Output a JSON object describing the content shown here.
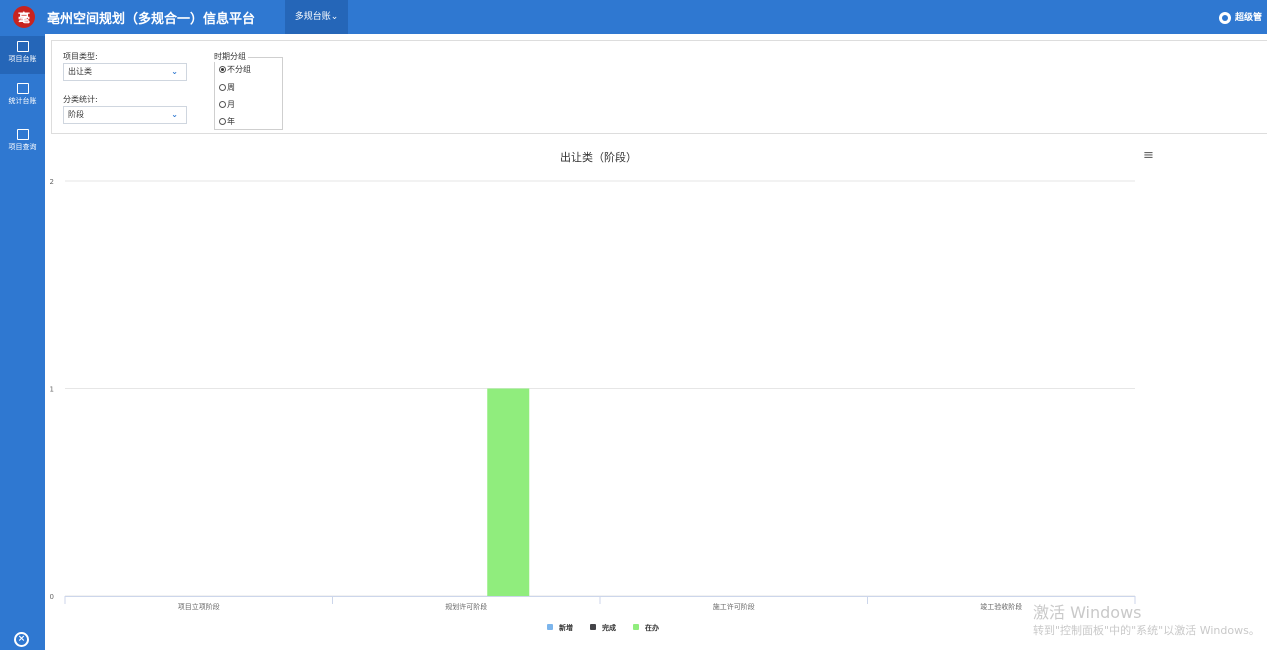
{
  "app": {
    "logo_glyph": "毫",
    "title": "亳州空间规划（多规合一）信息平台",
    "menu_active": "多规台账⌄",
    "user": "超级管"
  },
  "sidebar": {
    "items": [
      {
        "label": "项目台账",
        "icon": "ledger-icon"
      },
      {
        "label": "统计台账",
        "icon": "statistics-icon"
      },
      {
        "label": "项目查询",
        "icon": "query-icon"
      }
    ],
    "close_icon": "close-circle-icon"
  },
  "filters": {
    "type_label": "项目类型:",
    "type_value": "出让类",
    "class_label": "分类统计:",
    "class_value": "阶段",
    "period_title": "时期分组",
    "period_options": [
      "不分组",
      "周",
      "月",
      "年"
    ],
    "period_selected": "不分组"
  },
  "chart_data": {
    "type": "bar",
    "title": "出让类（阶段）",
    "categories": [
      "项目立项阶段",
      "规划许可阶段",
      "施工许可阶段",
      "竣工验收阶段"
    ],
    "series": [
      {
        "name": "新增",
        "color": "#7cb5ec",
        "values": [
          0,
          0,
          0,
          0
        ]
      },
      {
        "name": "完成",
        "color": "#434348",
        "values": [
          0,
          0,
          0,
          0
        ]
      },
      {
        "name": "在办",
        "color": "#90ed7d",
        "values": [
          0,
          1,
          0,
          0
        ]
      }
    ],
    "ylim": [
      0,
      2
    ],
    "yticks": [
      "0",
      "1",
      "2"
    ],
    "grid": true,
    "legend": "bottom-center"
  },
  "watermark": {
    "line1": "激活 Windows",
    "line2": "转到\"控制面板\"中的\"系统\"以激活 Windows。"
  },
  "colors": {
    "topbar": "#2f78d1",
    "sidebar": "#2f78d1",
    "logo": "#c8231f"
  }
}
